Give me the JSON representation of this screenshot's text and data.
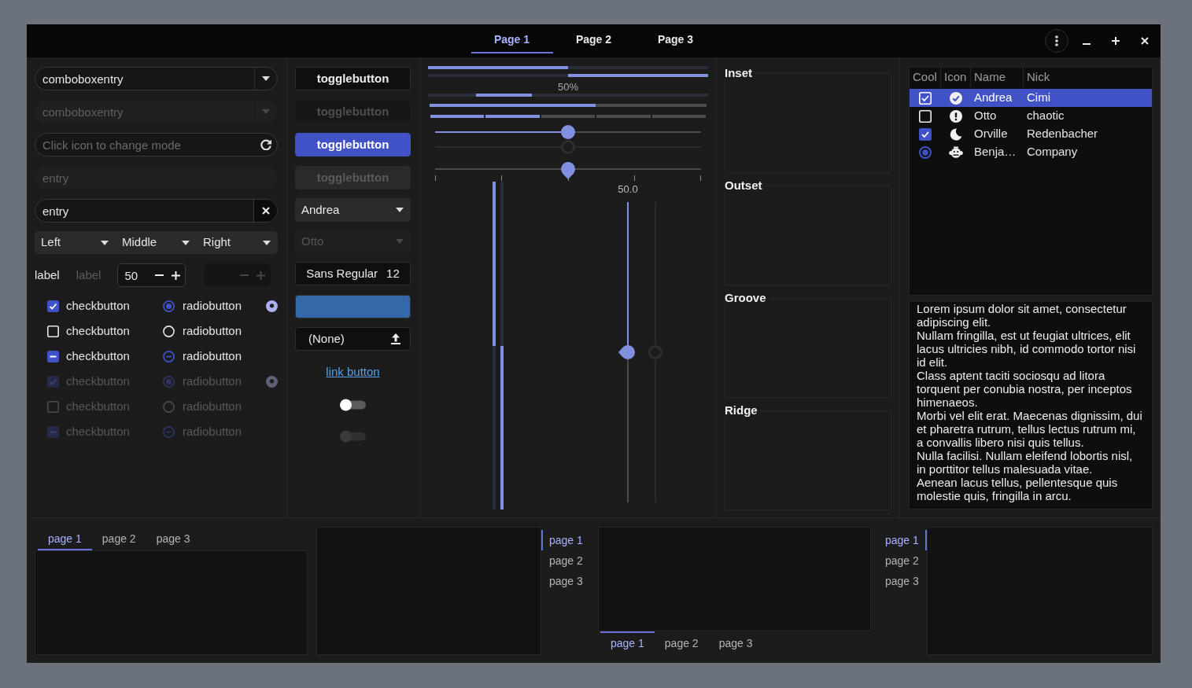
{
  "header": {
    "tabs": [
      {
        "label": "Page 1",
        "selected": true
      },
      {
        "label": "Page 2",
        "selected": false
      },
      {
        "label": "Page 3",
        "selected": false
      }
    ]
  },
  "entries": [
    {
      "kind": "combo",
      "value": "comboboxentry",
      "disabled": false
    },
    {
      "kind": "combo",
      "value": "comboboxentry",
      "disabled": true
    },
    {
      "kind": "icon",
      "placeholder": "Click icon to change mode",
      "disabled": false
    },
    {
      "kind": "plain",
      "value": "entry",
      "disabled": true
    },
    {
      "kind": "clear",
      "value": "entry",
      "disabled": false
    }
  ],
  "linked_combos": [
    {
      "value": "Left"
    },
    {
      "value": "Middle"
    },
    {
      "value": "Right"
    }
  ],
  "labels": [
    {
      "text": "label",
      "disabled": false
    },
    {
      "text": "label",
      "disabled": true
    }
  ],
  "spin_buttons": [
    {
      "value": "50",
      "disabled": false
    },
    {
      "disabled": true
    }
  ],
  "check_buttons": [
    {
      "label": "checkbutton",
      "checked": true,
      "inconsistent": false,
      "disabled": false
    },
    {
      "label": "checkbutton",
      "checked": false,
      "inconsistent": false,
      "disabled": false
    },
    {
      "label": "checkbutton",
      "checked": true,
      "inconsistent": true,
      "disabled": false
    },
    {
      "label": "checkbutton",
      "checked": true,
      "inconsistent": false,
      "disabled": true
    },
    {
      "label": "checkbutton",
      "checked": false,
      "inconsistent": false,
      "disabled": true
    },
    {
      "label": "checkbutton",
      "checked": true,
      "inconsistent": true,
      "disabled": true
    }
  ],
  "radio_buttons": [
    {
      "label": "radiobutton",
      "selected": true,
      "inconsistent": false,
      "disabled": false
    },
    {
      "label": "radiobutton",
      "selected": false,
      "inconsistent": false,
      "disabled": false
    },
    {
      "label": "radiobutton",
      "selected": false,
      "inconsistent": true,
      "disabled": false
    },
    {
      "label": "radiobutton",
      "selected": true,
      "inconsistent": false,
      "disabled": true
    },
    {
      "label": "radiobutton",
      "selected": false,
      "inconsistent": false,
      "disabled": true
    },
    {
      "label": "radiobutton",
      "selected": false,
      "inconsistent": true,
      "disabled": true
    }
  ],
  "indicator_radios": [
    {
      "selected": true,
      "disabled": false
    },
    {
      "selected": true,
      "disabled": true
    }
  ],
  "toggle_buttons": [
    {
      "label": "togglebutton",
      "active": false,
      "disabled": false
    },
    {
      "label": "togglebutton",
      "active": false,
      "disabled": true
    },
    {
      "label": "togglebutton",
      "active": true,
      "disabled": false
    },
    {
      "label": "togglebutton",
      "active": true,
      "disabled": true
    }
  ],
  "combo_boxes": [
    {
      "value": "Andrea",
      "disabled": false
    },
    {
      "value": "Otto",
      "disabled": true
    }
  ],
  "font_button": {
    "family": "Sans Regular",
    "size": "12"
  },
  "color_button": {
    "color": "#3468a8"
  },
  "file_button": {
    "label": "(None)"
  },
  "link_button": {
    "label": "link button"
  },
  "switches": [
    {
      "on": false,
      "disabled": false
    },
    {
      "on": false,
      "disabled": true
    }
  ],
  "progress_bars": [
    {
      "kind": "bar",
      "level": 0.5,
      "inverted": false
    },
    {
      "kind": "bar",
      "level": 0.5,
      "inverted": true
    },
    {
      "kind": "activity",
      "text": "50%",
      "level": 0.2
    }
  ],
  "level_bars": [
    {
      "kind": "continuous",
      "level": 0.6
    },
    {
      "kind": "discrete",
      "segments": [
        {
          "filled": true
        },
        {
          "filled": true
        },
        {
          "filled": false
        },
        {
          "filled": false
        },
        {
          "filled": false
        }
      ]
    }
  ],
  "scales": [
    {
      "kind": "fill",
      "level": 0.5,
      "disabled": false
    },
    {
      "kind": "fill",
      "level": 0.5,
      "disabled": true
    },
    {
      "kind": "marks",
      "level": 0.5,
      "disabled": false
    }
  ],
  "vertical_progress_bars": [
    {
      "level": 0.5,
      "inverted": false
    },
    {
      "level": 0.5,
      "inverted": true
    }
  ],
  "vertical_scales": [
    {
      "value_text": "50.0",
      "level": 0.5,
      "disabled": false
    },
    {
      "level": 0.5,
      "disabled": true
    }
  ],
  "frames": [
    {
      "title": "Inset"
    },
    {
      "title": "Outset"
    },
    {
      "title": "Groove"
    },
    {
      "title": "Ridge"
    }
  ],
  "tree": {
    "columns": [
      "Cool",
      "Icon",
      "Name",
      "Nick"
    ],
    "rows": [
      {
        "cool": {
          "kind": "check",
          "checked": true
        },
        "name": "Andrea",
        "nick": "Cimi",
        "selected": true
      },
      {
        "cool": {
          "kind": "check",
          "checked": false
        },
        "name": "Otto",
        "nick": "chaotic",
        "selected": false
      },
      {
        "cool": {
          "kind": "check",
          "checked": true
        },
        "name": "Orville",
        "nick": "Redenbacher",
        "selected": false
      },
      {
        "cool": {
          "kind": "radio",
          "checked": true
        },
        "name": "Benja…",
        "nick": "Company",
        "selected": false
      }
    ]
  },
  "text_view": {
    "paragraphs": [
      "Lorem ipsum dolor sit amet, consectetur adipiscing elit.",
      "Nullam fringilla, est ut feugiat ultrices, elit lacus ultricies nibh, id commodo tortor nisi id elit.",
      "Class aptent taciti sociosqu ad litora torquent per conubia nostra, per inceptos himenaeos.",
      "Morbi vel elit erat. Maecenas dignissim, dui et pharetra rutrum, tellus lectus rutrum mi, a convallis libero nisi quis tellus.",
      "Nulla facilisi. Nullam eleifend lobortis nisl, in porttitor tellus malesuada vitae.",
      "Aenean lacus tellus, pellentesque quis molestie quis, fringilla in arcu."
    ]
  },
  "notebooks": [
    {
      "kind": "top",
      "tabs": [
        {
          "label": "page 1",
          "selected": true
        },
        {
          "label": "page 2",
          "selected": false
        },
        {
          "label": "page 3",
          "selected": false
        }
      ]
    },
    {
      "kind": "right",
      "tabs": [
        {
          "label": "page 1",
          "selected": true
        },
        {
          "label": "page 2",
          "selected": false
        },
        {
          "label": "page 3",
          "selected": false
        }
      ]
    },
    {
      "kind": "bottom",
      "tabs": [
        {
          "label": "page 1",
          "selected": true
        },
        {
          "label": "page 2",
          "selected": false
        },
        {
          "label": "page 3",
          "selected": false
        }
      ]
    },
    {
      "kind": "left",
      "tabs": [
        {
          "label": "page 1",
          "selected": true
        },
        {
          "label": "page 2",
          "selected": false
        },
        {
          "label": "page 3",
          "selected": false
        }
      ]
    }
  ]
}
